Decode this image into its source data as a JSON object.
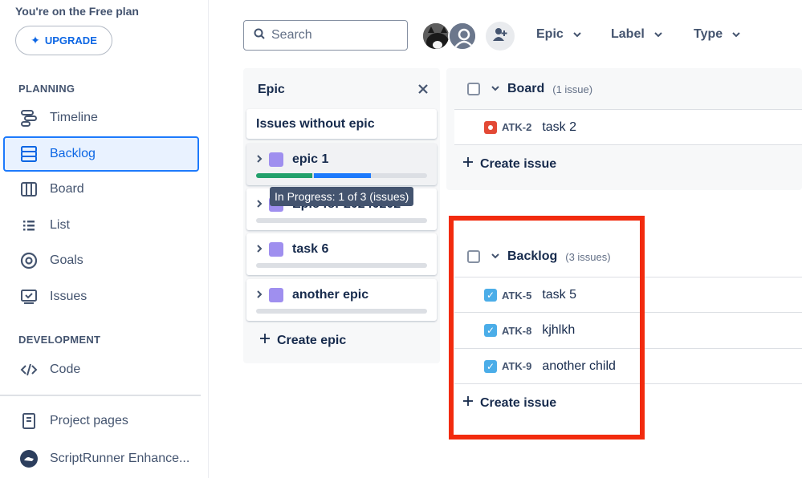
{
  "plan": {
    "text": "You're on the Free plan",
    "upgrade_label": "UPGRADE"
  },
  "sidebar": {
    "planning_header": "PLANNING",
    "development_header": "DEVELOPMENT",
    "items": [
      {
        "label": "Timeline",
        "icon": "timeline-icon"
      },
      {
        "label": "Backlog",
        "icon": "backlog-icon",
        "active": true
      },
      {
        "label": "Board",
        "icon": "board-icon"
      },
      {
        "label": "List",
        "icon": "list-icon"
      },
      {
        "label": "Goals",
        "icon": "goals-icon"
      },
      {
        "label": "Issues",
        "icon": "issues-icon"
      },
      {
        "label": "Code",
        "icon": "code-icon"
      },
      {
        "label": "Project pages",
        "icon": "page-icon"
      },
      {
        "label": "ScriptRunner Enhance...",
        "icon": "scriptrunner-icon"
      }
    ]
  },
  "toolbar": {
    "search_placeholder": "Search",
    "filters": [
      "Epic",
      "Label",
      "Type"
    ]
  },
  "epic_panel": {
    "title": "Epic",
    "without_epic": "Issues without epic",
    "epics": [
      {
        "name": "epic 1",
        "progress": {
          "done": 0.33,
          "in_progress": 0.33
        }
      },
      {
        "name": "Epic for 20240202",
        "progress": {
          "done": 0,
          "in_progress": 0
        }
      },
      {
        "name": "task 6",
        "progress": {
          "done": 0,
          "in_progress": 0
        }
      },
      {
        "name": "another epic",
        "progress": {
          "done": 0,
          "in_progress": 0
        }
      }
    ],
    "tooltip": "In Progress: 1 of 3 (issues)",
    "create_label": "Create epic",
    "colors": {
      "epic": "#9f8fef",
      "done": "#22a06b",
      "in_progress": "#1d7afc"
    }
  },
  "board_sprint": {
    "name": "Board",
    "count": "(1 issue)",
    "issues": [
      {
        "key": "ATK-2",
        "summary": "task 2",
        "type": "bug"
      }
    ],
    "create_label": "Create issue"
  },
  "backlog": {
    "name": "Backlog",
    "count": "(3 issues)",
    "issues": [
      {
        "key": "ATK-5",
        "summary": "task 5",
        "type": "task"
      },
      {
        "key": "ATK-8",
        "summary": "kjhlkh",
        "type": "task"
      },
      {
        "key": "ATK-9",
        "summary": "another child",
        "type": "task"
      }
    ],
    "create_label": "Create issue",
    "highlight_color": "#f22b0e"
  }
}
